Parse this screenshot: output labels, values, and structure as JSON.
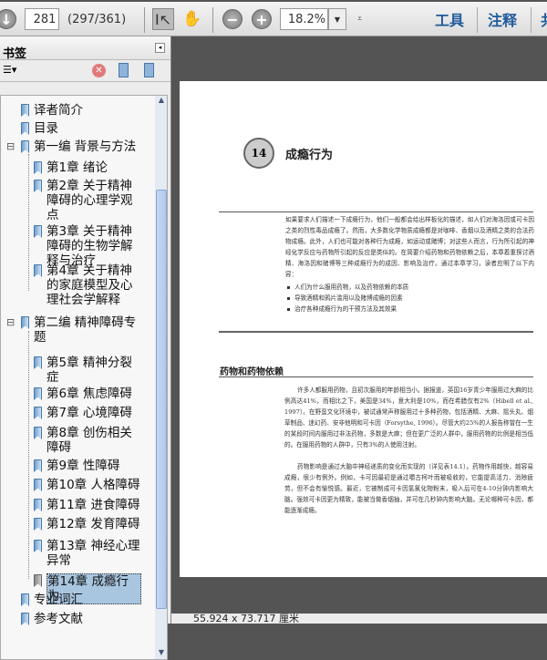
{
  "toolbar": {
    "page_number": "281",
    "page_count": "(297/361)",
    "zoom": "18.2%",
    "menu_tools": "工具",
    "menu_comment": "注释",
    "menu_share": "共"
  },
  "panel": {
    "title": "书签"
  },
  "bookmarks": [
    {
      "label": "译者简介",
      "level": 0
    },
    {
      "label": "目录",
      "level": 0
    },
    {
      "label": "第一编 背景与方法",
      "level": 0,
      "expanded": true
    },
    {
      "label": "第1章 绪论",
      "level": 1
    },
    {
      "label": "第2章 关于精神障碍的心理学观点",
      "level": 1
    },
    {
      "label": "第3章 关于精神障碍的生物学解释与治疗",
      "level": 1
    },
    {
      "label": "第4章 关于精神的家庭模型及心理社会学解释",
      "level": 1
    },
    {
      "label": "第二编 精神障碍专题",
      "level": 0,
      "expanded": true
    },
    {
      "label": "第5章 精神分裂症",
      "level": 1
    },
    {
      "label": "第6章 焦虑障碍",
      "level": 1
    },
    {
      "label": "第7章 心境障碍",
      "level": 1
    },
    {
      "label": "第8章 创伤相关障碍",
      "level": 1
    },
    {
      "label": "第9章 性障碍",
      "level": 1
    },
    {
      "label": "第10章 人格障碍",
      "level": 1
    },
    {
      "label": "第11章 进食障碍",
      "level": 1
    },
    {
      "label": "第12章 发育障碍",
      "level": 1
    },
    {
      "label": "第13章 神经心理异常",
      "level": 1
    },
    {
      "label": "第14章 成瘾行为",
      "level": 1,
      "selected": true
    },
    {
      "label": "专业词汇",
      "level": 0
    },
    {
      "label": "参考文献",
      "level": 0
    }
  ],
  "document": {
    "chapter_number": "14",
    "chapter_title": "成瘾行为",
    "intro": "如果要求人们描述一下成瘾行为，他们一般都会给出样板化的描述，如人们对海洛因或可卡因之类的烈性毒品成瘾了。然而，大多数化学物质成瘾都是对咖啡、香烟以及酒精之类的合法药物成瘾。此外，人们也可能对各种行为成瘾，如运动或赌博；对这些人而言，行为所引起的神经化学反应与药物所引起的反应是类似的。在简要介绍药物和药物依赖之后，本章着重探讨酒精、海洛因和赌博等三种成瘾行为的成因、影响及治疗。通过本章学习，读者应明了以下内容：",
    "bullets": [
      "人们为什么服用药物，以及药物依赖的本质",
      "导致酒精和鸦片滥用以及赌博成瘾的因素",
      "治疗各种成瘾行为的干预方法及其效果"
    ],
    "section_title": "药物和药物依赖",
    "para1": "许多人都服用药物，且初次服用的年龄相当小。据报道，英国16岁青少年服用过大麻的比例高达41%，而相比之下，美国是34%，意大利是10%，而在希腊仅有2%（Hibell et al., 1997）。在野蛮文化环境中，被试通常声称服用过十多种药物，包括酒精、大麻、摇头丸、烟草制品、迷幻药、安非他明和可卡因（Forsythe, 1996）。尽管大约25%的人报告称曾在一生的某段时间内服用过非法药物，多数是大麻；但在更广泛的人群中，服用药物的比例是相当低的。在服用药物的人群中，只有3%的人使用注射。",
    "para2": "药物影响是通过大脑中神经递质的变化而实现的（详见表14.1）。药物作用越快，越容易成瘾，很少有例外。例如，卡可因最初是通过嚼古柯叶而被吸收的，它能提高活力、消除疲劳，但不会有愉悦感。最近，它被制成可卡因氢氯化物粉末，吸入后可在4-10分钟内影响大脑。强效可卡因更为精致，能被当做香烟抽，并可在几秒钟内影响大脑。无论哪种可卡因，都能逐渐成瘾。"
  },
  "status": {
    "page_size": "55.924 x 73.717 厘米"
  }
}
